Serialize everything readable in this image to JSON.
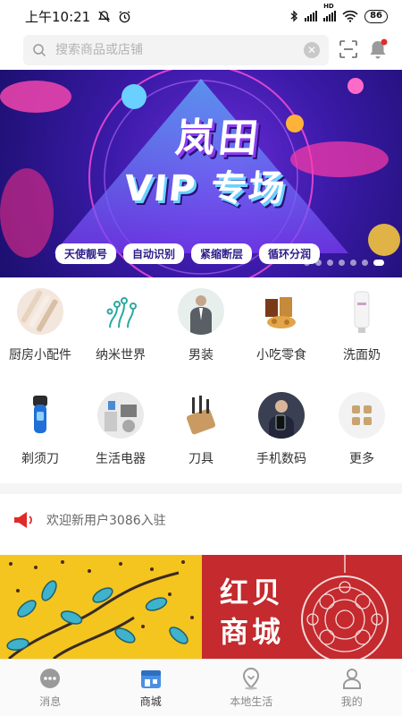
{
  "status_bar": {
    "time": "上午10:21",
    "battery": "86",
    "network": "HD"
  },
  "search": {
    "placeholder": "搜索商品或店铺"
  },
  "icons": {
    "search": "search-icon",
    "clear": "clear-icon",
    "scan": "scan-icon",
    "notification": "bell-icon"
  },
  "banner": {
    "title_line1": "岚田",
    "title_line2": "VIP 专场",
    "tags": [
      "天使靓号",
      "自动识别",
      "紧缩断层",
      "循环分润"
    ],
    "slide_count": 7,
    "active_slide": 7
  },
  "categories": [
    {
      "label": "厨房小配件",
      "icon": "kitchen-tools-icon"
    },
    {
      "label": "纳米世界",
      "icon": "nano-icon"
    },
    {
      "label": "男装",
      "icon": "menswear-icon"
    },
    {
      "label": "小吃零食",
      "icon": "snacks-icon"
    },
    {
      "label": "洗面奶",
      "icon": "cleanser-icon"
    },
    {
      "label": "剃须刀",
      "icon": "shaver-icon"
    },
    {
      "label": "生活电器",
      "icon": "appliance-icon"
    },
    {
      "label": "刀具",
      "icon": "knife-icon"
    },
    {
      "label": "手机数码",
      "icon": "phone-digital-icon"
    },
    {
      "label": "更多",
      "icon": "more-grid-icon"
    }
  ],
  "notice": {
    "text": "欢迎新用户3086入驻",
    "icon": "megaphone-icon"
  },
  "promo": {
    "title": "红贝商城",
    "title_line1": "红贝",
    "title_line2": "商城"
  },
  "tabbar": {
    "items": [
      {
        "label": "消息",
        "icon": "message-icon"
      },
      {
        "label": "商城",
        "icon": "store-icon",
        "active": true
      },
      {
        "label": "本地生活",
        "icon": "location-icon"
      },
      {
        "label": "我的",
        "icon": "profile-icon"
      }
    ]
  },
  "colors": {
    "accent_red": "#e02b2b",
    "promo_yellow": "#f4c51e",
    "promo_red": "#c42a2e",
    "banner_purple": "#3b1aa8"
  }
}
